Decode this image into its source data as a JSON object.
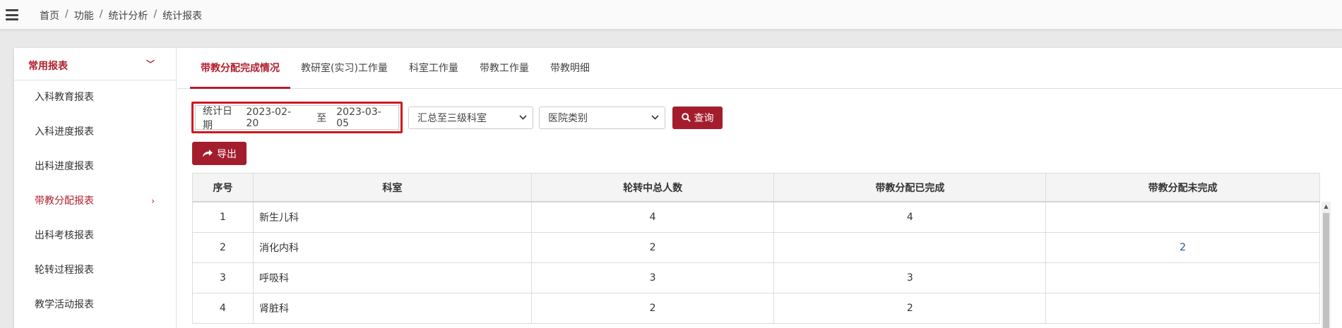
{
  "breadcrumb": [
    "首页",
    "功能",
    "统计分析",
    "统计报表"
  ],
  "sidebar": {
    "header": "常用报表",
    "items": [
      {
        "label": "入科教育报表"
      },
      {
        "label": "入科进度报表"
      },
      {
        "label": "出科进度报表"
      },
      {
        "label": "带教分配报表",
        "active": true
      },
      {
        "label": "出科考核报表"
      },
      {
        "label": "轮转过程报表"
      },
      {
        "label": "教学活动报表"
      }
    ]
  },
  "tabs": [
    "带教分配完成情况",
    "教研室(实习)工作量",
    "科室工作量",
    "带教工作量",
    "带教明细"
  ],
  "filters": {
    "date_label": "统计日期",
    "start_date": "2023-02-20",
    "to_label": "至",
    "end_date": "2023-03-05",
    "summary_select": "汇总至三级科室",
    "hospital_select": "医院类别",
    "query_button": "查询"
  },
  "export_button": "导出",
  "table": {
    "headers": [
      "序号",
      "科室",
      "轮转中总人数",
      "带教分配已完成",
      "带教分配未完成"
    ],
    "rows": [
      [
        "1",
        "新生儿科",
        "4",
        "4",
        ""
      ],
      [
        "2",
        "消化内科",
        "2",
        "",
        "2"
      ],
      [
        "3",
        "呼吸科",
        "3",
        "3",
        ""
      ],
      [
        "4",
        "肾脏科",
        "2",
        "2",
        ""
      ]
    ]
  },
  "colors": {
    "accent": "#b0202e",
    "highlight_border": "#d0191e",
    "link": "#1f4fa0"
  },
  "icons": {
    "menu": "hamburger-icon",
    "dropdown": "chevron-down-icon",
    "sidebar_arrow": "chevron-right-icon",
    "search": "search-icon",
    "export": "share-arrow-icon"
  }
}
